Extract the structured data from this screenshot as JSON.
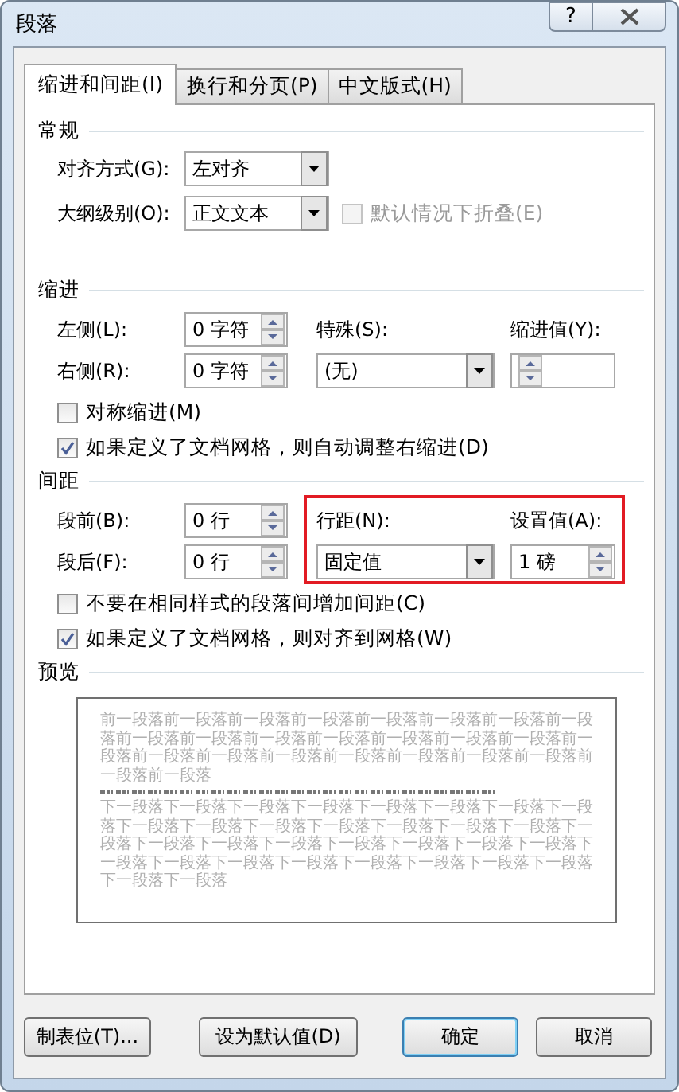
{
  "window": {
    "title": "段落",
    "help": "?"
  },
  "tabs": [
    {
      "label": "缩进和间距(I)",
      "selected": true
    },
    {
      "label": "换行和分页(P)",
      "selected": false
    },
    {
      "label": "中文版式(H)",
      "selected": false
    }
  ],
  "general": {
    "heading": "常规",
    "alignment": {
      "label": "对齐方式(G):",
      "value": "左对齐"
    },
    "outline_level": {
      "label": "大纲级别(O):",
      "value": "正文文本"
    },
    "collapse": {
      "label": "默认情况下折叠(E)",
      "checked": false,
      "disabled": true
    }
  },
  "indentation": {
    "heading": "缩进",
    "left": {
      "label": "左侧(L):",
      "value": "0 字符"
    },
    "right": {
      "label": "右侧(R):",
      "value": "0 字符"
    },
    "special": {
      "label": "特殊(S):",
      "value": "(无)"
    },
    "by": {
      "label": "缩进值(Y):"
    },
    "checkboxes": [
      {
        "label": "对称缩进(M)",
        "checked": false
      },
      {
        "label": "如果定义了文档网格，则自动调整右缩进(D)",
        "checked": true
      }
    ]
  },
  "spacing": {
    "heading": "间距",
    "before": {
      "label": "段前(B):",
      "value": "0 行"
    },
    "after": {
      "label": "段后(F):",
      "value": "0 行"
    },
    "line_spacing": {
      "label": "行距(N):",
      "value": "固定值"
    },
    "at": {
      "label": "设置值(A):",
      "value": "1 磅"
    },
    "highlighted": true,
    "checkboxes": [
      {
        "label": "不要在相同样式的段落间增加间距(C)",
        "checked": false
      },
      {
        "label": "如果定义了文档网格，则对齐到网格(W)",
        "checked": true
      }
    ]
  },
  "preview": {
    "heading": "预览",
    "previous_text": "前一段落前一段落前一段落前一段落前一段落前一段落前一段落前一段落前一段落前一段落前一段落前一段落前一段落前一段落前一段落前一段落前一段落前一段落前一段落前一段落前一段落前一段落前一段落前一段落前一段落",
    "next_text": "下一段落下一段落下一段落下一段落下一段落下一段落下一段落下一段落下一段落下一段落下一段落下一段落下一段落下一段落下一段落下一段落下一段落下一段落下一段落下一段落下一段落下一段落下一段落下一段落下一段落下一段落下一段落下一段落下一段落下一段落下一段落下一段落下一段落"
  },
  "buttons": [
    {
      "label": "制表位(T)...",
      "default": false
    },
    {
      "label": "设为默认值(D)",
      "default": false
    },
    {
      "label": "确定",
      "default": true
    },
    {
      "label": "取消",
      "default": false
    }
  ]
}
